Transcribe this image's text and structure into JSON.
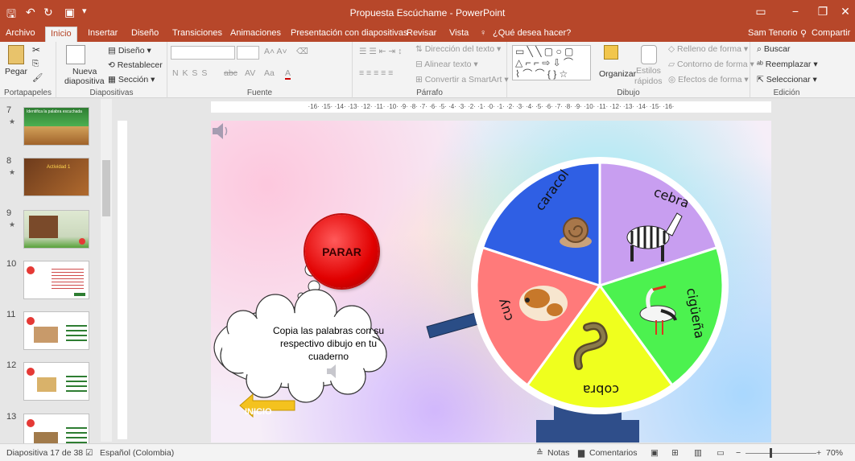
{
  "window": {
    "title": "Propuesta Escúchame - PowerPoint",
    "accent": "#b7472a"
  },
  "menu": {
    "tabs": [
      "Archivo",
      "Inicio",
      "Insertar",
      "Diseño",
      "Transiciones",
      "Animaciones",
      "Presentación con diapositivas",
      "Revisar",
      "Vista"
    ],
    "active_tab": "Inicio",
    "tell_me": "¿Qué desea hacer?",
    "user": "Sam Tenorio",
    "share": "Compartir"
  },
  "ribbon": {
    "portapapeles": {
      "label": "Portapapeles",
      "pegar": "Pegar"
    },
    "diapositivas": {
      "label": "Diapositivas",
      "nueva_1": "Nueva",
      "nueva_2": "diapositiva",
      "diseno": "Diseño",
      "restablecer": "Restablecer",
      "seccion": "Sección"
    },
    "fuente": {
      "label": "Fuente",
      "format_buttons": "N  K  S  S",
      "abc": "abc"
    },
    "parrafo": {
      "label": "Párrafo",
      "direccion": "Dirección del texto",
      "alinear": "Alinear texto",
      "smartart": "Convertir a SmartArt"
    },
    "dibujo": {
      "label": "Dibujo",
      "organizar": "Organizar",
      "estilos_1": "Estilos",
      "estilos_2": "rápidos",
      "relleno": "Relleno de forma",
      "contorno": "Contorno de forma",
      "efectos": "Efectos de forma"
    },
    "edicion": {
      "label": "Edición",
      "buscar": "Buscar",
      "reemplazar": "Reemplazar",
      "seleccionar": "Seleccionar"
    }
  },
  "slides": [
    {
      "num": "7",
      "star": "★",
      "caption": "Identifica la palabra escuchada"
    },
    {
      "num": "8",
      "star": "★",
      "caption": "Actividad 1"
    },
    {
      "num": "9",
      "star": "★",
      "caption": ""
    },
    {
      "num": "10",
      "star": "",
      "caption": ""
    },
    {
      "num": "11",
      "star": "",
      "caption": ""
    },
    {
      "num": "12",
      "star": "",
      "caption": ""
    },
    {
      "num": "13",
      "star": "",
      "caption": ""
    }
  ],
  "ruler": {
    "horizontal": "·16· ·15· ·14· ·13· ·12· ·11· ·10· ·9· ·8· ·7· ·6· ·5· ·4· ·3· ·2· ·1· ·0· ·1· ·2· ·3· ·4· ·5· ·6· ·7· ·8· ·9· ·10· ·11· ·12· ·13· ·14· ·15· ·16·"
  },
  "slide": {
    "stop_button": "PARAR",
    "cloud_text": "Copia las palabras con su respectivo dibujo en tu cuaderno",
    "home_button": "INICIO",
    "wheel": [
      {
        "word": "caracol",
        "color": "#2f5fe4"
      },
      {
        "word": "cebra",
        "color": "#c89ef0"
      },
      {
        "word": "cigüeña",
        "color": "#4cf24f"
      },
      {
        "word": "cobra",
        "color": "#efff1e"
      },
      {
        "word": "cuy",
        "color": "#ff7a7a"
      }
    ]
  },
  "status": {
    "slide_info": "Diapositiva 17 de 38",
    "language": "Español (Colombia)",
    "notes": "Notas",
    "comments": "Comentarios",
    "zoom": "70%"
  }
}
